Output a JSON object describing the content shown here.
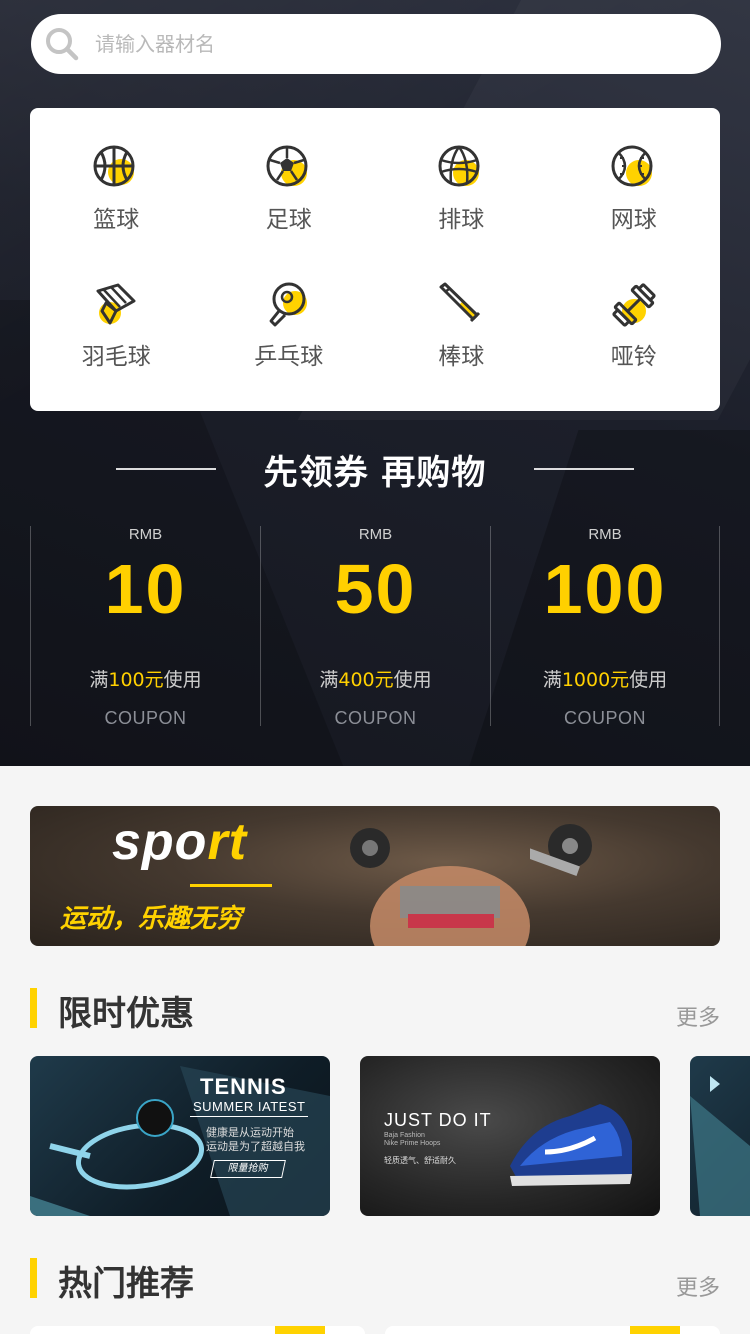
{
  "search": {
    "placeholder": "请输入器材名"
  },
  "categories": [
    {
      "label": "篮球",
      "icon": "basketball-icon"
    },
    {
      "label": "足球",
      "icon": "football-icon"
    },
    {
      "label": "排球",
      "icon": "volleyball-icon"
    },
    {
      "label": "网球",
      "icon": "tennis-icon"
    },
    {
      "label": "羽毛球",
      "icon": "badminton-icon"
    },
    {
      "label": "乒乓球",
      "icon": "table-tennis-icon"
    },
    {
      "label": "棒球",
      "icon": "baseball-bat-icon"
    },
    {
      "label": "哑铃",
      "icon": "dumbbell-icon"
    }
  ],
  "coupon_section": {
    "title": "先领券 再购物",
    "coupons": [
      {
        "currency": "RMB",
        "amount": "10",
        "cond_prefix": "满",
        "cond_value": "100元",
        "cond_suffix": "使用",
        "code": "COUPON"
      },
      {
        "currency": "RMB",
        "amount": "50",
        "cond_prefix": "满",
        "cond_value": "400元",
        "cond_suffix": "使用",
        "code": "COUPON"
      },
      {
        "currency": "RMB",
        "amount": "100",
        "cond_prefix": "满",
        "cond_value": "1000元",
        "cond_suffix": "使用",
        "code": "COUPON"
      }
    ]
  },
  "banner": {
    "word_white": "spo",
    "word_yellow": "rt",
    "slogan": "运动，乐趣无穷"
  },
  "limited": {
    "title": "限时优惠",
    "more": "更多",
    "deals": [
      {
        "title": "TENNIS",
        "subtitle": "SUMMER IATEST",
        "line1": "健康是从运动开始",
        "line2": "运动是为了超越自我",
        "button": "限量抢购"
      },
      {
        "title": "JUST DO IT",
        "small1": "Baja Fashion",
        "small2": "Nike Prime Hoops",
        "tagline": "轻质透气、舒适耐久"
      }
    ]
  },
  "hot": {
    "title": "热门推荐",
    "more": "更多"
  },
  "colors": {
    "accent": "#ffd200",
    "dark_bg": "#1c1f2a",
    "white": "#ffffff"
  }
}
